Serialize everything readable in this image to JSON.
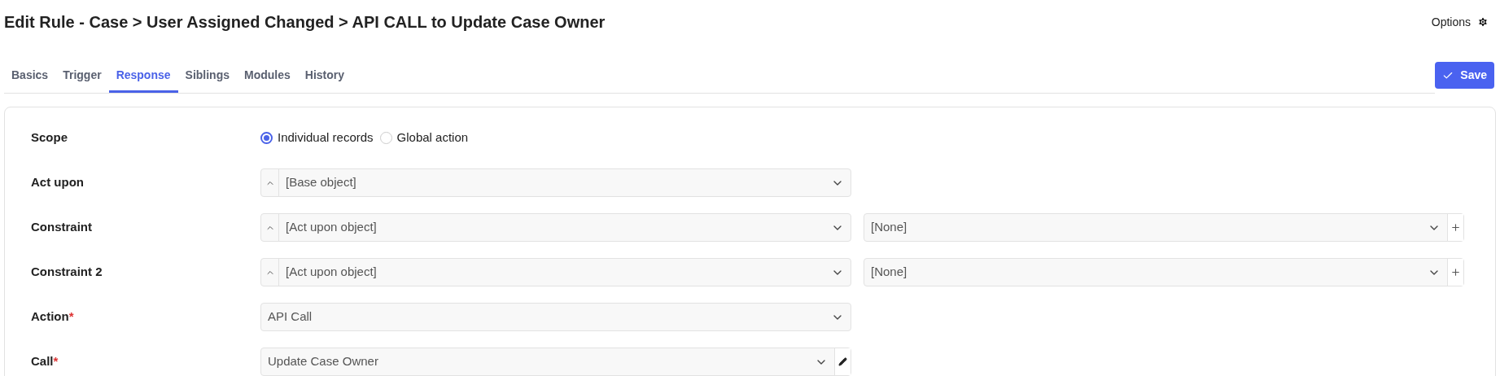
{
  "title": "Edit Rule - Case > User Assigned Changed > API CALL to Update Case Owner",
  "options_label": "Options",
  "tabs": [
    {
      "label": "Basics",
      "selected": false
    },
    {
      "label": "Trigger",
      "selected": false
    },
    {
      "label": "Response",
      "selected": true
    },
    {
      "label": "Siblings",
      "selected": false
    },
    {
      "label": "Modules",
      "selected": false
    },
    {
      "label": "History",
      "selected": false
    }
  ],
  "save_button": "Save",
  "rows": [
    {
      "label": "Scope",
      "kind": "radio",
      "options": [
        {
          "label": "Individual records",
          "selected": true
        },
        {
          "label": "Global action",
          "selected": false
        }
      ]
    },
    {
      "label": "Act upon",
      "kind": "select",
      "collapse": true,
      "edit": false,
      "value": "[Base object]"
    },
    {
      "label": "Constraint",
      "kind": "select",
      "collapse": true,
      "edit": false,
      "value": "[Act upon object]",
      "secondary": {
        "value": "[None]"
      }
    },
    {
      "label": "Constraint 2",
      "kind": "select",
      "collapse": true,
      "edit": false,
      "value": "[Act upon object]",
      "secondary": {
        "value": "[None]"
      }
    },
    {
      "label": "Action",
      "required_mark": "*",
      "kind": "select",
      "collapse": false,
      "edit": false,
      "value": "API Call"
    },
    {
      "label": "Call",
      "required_mark": "*",
      "kind": "select",
      "collapse": false,
      "edit": true,
      "value": "Update Case Owner"
    }
  ]
}
